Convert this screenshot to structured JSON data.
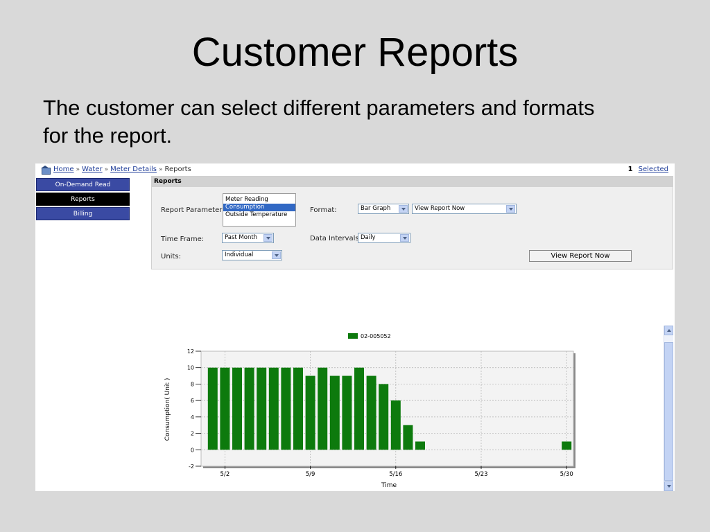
{
  "slide": {
    "title": "Customer Reports",
    "subtitle": "The customer can select different parameters and formats for the report."
  },
  "breadcrumb": {
    "items": [
      "Home",
      "Water",
      "Meter Details"
    ],
    "current": "Reports",
    "separator": "»"
  },
  "selection": {
    "count": "1",
    "link": "Selected"
  },
  "nav": {
    "items": [
      {
        "label": "On-Demand Read",
        "active": false
      },
      {
        "label": "Reports",
        "active": true
      },
      {
        "label": "Billing",
        "active": false
      }
    ]
  },
  "panel": {
    "title": "Reports",
    "report_parameter": {
      "label": "Report Parameter:",
      "options": [
        "Meter Reading",
        "Consumption",
        "Outside Temperature"
      ],
      "selected": "Consumption"
    },
    "format": {
      "label": "Format:",
      "value": "Bar Graph"
    },
    "view_mode": {
      "value": "View Report Now"
    },
    "time_frame": {
      "label": "Time Frame:",
      "value": "Past Month"
    },
    "data_intervals": {
      "label": "Data Intervals:",
      "value": "Daily"
    },
    "units": {
      "label": "Units:",
      "value": "Individual"
    },
    "view_button": "View Report Now"
  },
  "colors": {
    "bar": "#0d7a0d",
    "nav": "#3a4aa3",
    "nav_active": "#000000",
    "link": "#1f3d99",
    "selection": "#3168c4"
  },
  "chart_data": {
    "type": "bar",
    "title": "",
    "xlabel": "Time",
    "ylabel": "Consumption( Unit )",
    "ylim": [
      -2,
      12
    ],
    "yticks": [
      -2,
      0,
      2,
      4,
      6,
      8,
      10,
      12
    ],
    "x_tick_labels": [
      {
        "label": "5/2",
        "day": 2
      },
      {
        "label": "5/9",
        "day": 9
      },
      {
        "label": "5/16",
        "day": 16
      },
      {
        "label": "5/23",
        "day": 23
      },
      {
        "label": "5/30",
        "day": 30
      }
    ],
    "xlim_days": [
      1,
      31
    ],
    "legend": {
      "position": "top-center"
    },
    "grid": true,
    "series": [
      {
        "name": "02-005052",
        "points": [
          {
            "day": 1,
            "value": 10
          },
          {
            "day": 2,
            "value": 10
          },
          {
            "day": 3,
            "value": 10
          },
          {
            "day": 4,
            "value": 10
          },
          {
            "day": 5,
            "value": 10
          },
          {
            "day": 6,
            "value": 10
          },
          {
            "day": 7,
            "value": 10
          },
          {
            "day": 8,
            "value": 10
          },
          {
            "day": 9,
            "value": 9
          },
          {
            "day": 10,
            "value": 10
          },
          {
            "day": 11,
            "value": 9
          },
          {
            "day": 12,
            "value": 9
          },
          {
            "day": 13,
            "value": 10
          },
          {
            "day": 14,
            "value": 9
          },
          {
            "day": 15,
            "value": 8
          },
          {
            "day": 16,
            "value": 6
          },
          {
            "day": 17,
            "value": 3
          },
          {
            "day": 18,
            "value": 1
          },
          {
            "day": 30,
            "value": 1
          }
        ]
      }
    ]
  }
}
